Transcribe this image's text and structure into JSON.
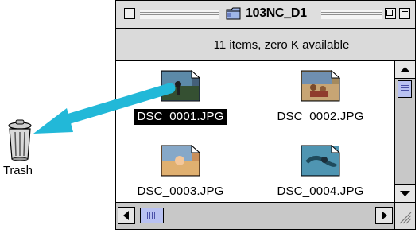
{
  "desktop": {
    "trash_label": "Trash"
  },
  "window": {
    "title": "103NC_D1",
    "status": "11 items, zero K available"
  },
  "files": [
    {
      "name": "DSC_0001.JPG",
      "selected": true
    },
    {
      "name": "DSC_0002.JPG",
      "selected": false
    },
    {
      "name": "DSC_0003.JPG",
      "selected": false
    },
    {
      "name": "DSC_0004.JPG",
      "selected": false
    }
  ],
  "icons": {
    "trash": "trash-can-icon",
    "folder": "folder-icon",
    "file": "jpeg-document-icon",
    "arrow": "drag-arrow"
  },
  "colors": {
    "accent_arrow": "#22b8d8",
    "scroll_thumb": "#b9c2f2",
    "selection": "#000000"
  }
}
